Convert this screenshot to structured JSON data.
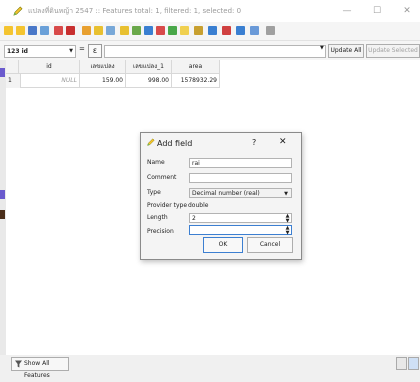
{
  "window": {
    "title": "แปลงที่ดินหญ้า 2547 :: Features total: 1, filtered: 1, selected: 0",
    "minimize": "—",
    "maximize": "☐",
    "close": "✕"
  },
  "expression_bar": {
    "field_select": "123 id",
    "equals": "=",
    "epsilon": "ε",
    "update_all": "Update All",
    "update_selected": "Update Selected"
  },
  "table": {
    "columns": [
      "id",
      "เลขแปลง",
      "เลขแปลง_1",
      "area"
    ],
    "rows": [
      {
        "num": "1",
        "cells": [
          "NULL",
          "159.00",
          "998.00",
          "1578932.29"
        ]
      }
    ]
  },
  "footer": {
    "show_all": "Show All Features"
  },
  "dialog": {
    "title": "Add field",
    "help": "?",
    "close": "✕",
    "name_label": "Name",
    "name_value": "rai",
    "comment_label": "Comment",
    "comment_value": "",
    "type_label": "Type",
    "type_value": "Decimal number (real)",
    "provider_label": "Provider type",
    "provider_value": "double",
    "length_label": "Length",
    "length_value": "2",
    "precision_label": "Precision",
    "precision_value": "",
    "ok": "OK",
    "cancel": "Cancel"
  },
  "colors": {
    "accent": "#3c7fd1",
    "pencil_yellow": "#f4c430"
  }
}
